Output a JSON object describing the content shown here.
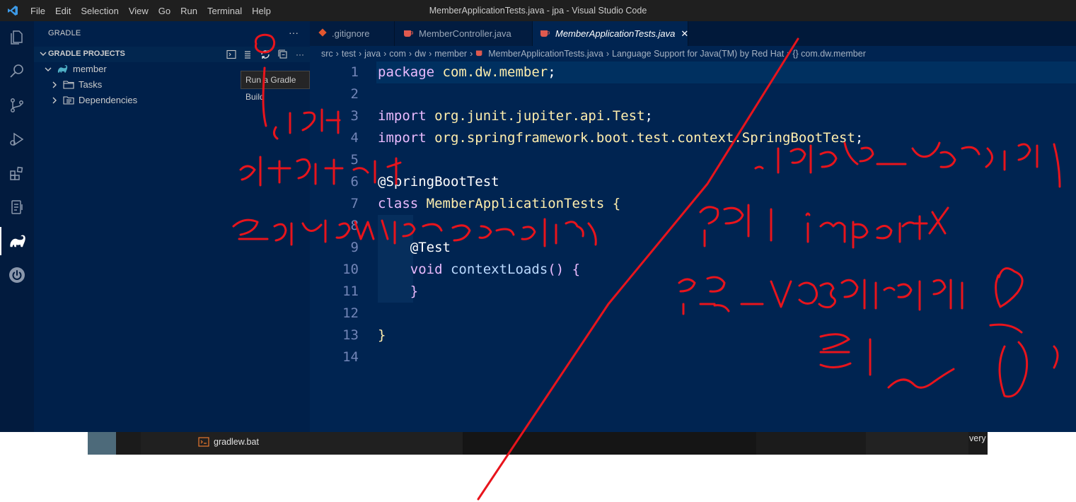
{
  "titlebar": {
    "menu": [
      "File",
      "Edit",
      "Selection",
      "View",
      "Go",
      "Run",
      "Terminal",
      "Help"
    ],
    "window_title": "MemberApplicationTests.java - jpa - Visual Studio Code"
  },
  "activity_bar": {
    "items": [
      "explorer-icon",
      "search-icon",
      "source-control-icon",
      "run-debug-icon",
      "extensions-icon",
      "test-icon",
      "gradle-icon",
      "spring-boot-icon"
    ],
    "active": "gradle-icon"
  },
  "sidebar": {
    "title": "GRADLE",
    "more": "···",
    "section_title": "GRADLE PROJECTS",
    "project": "member",
    "tree": [
      "Tasks",
      "Dependencies"
    ],
    "tooltip": "Run a Gradle Build"
  },
  "tabs": [
    {
      "label": ".gitignore",
      "icon": "gitignore-icon"
    },
    {
      "label": "MemberController.java",
      "icon": "java-icon"
    },
    {
      "label": "MemberApplicationTests.java",
      "icon": "java-icon",
      "active": true,
      "close": "✕"
    }
  ],
  "breadcrumb": [
    "src",
    "test",
    "java",
    "com",
    "dw",
    "member",
    "MemberApplicationTests.java",
    "Language Support for Java(TM) by Red Hat",
    "{} com.dw.member"
  ],
  "editor": {
    "line_numbers": [
      "1",
      "2",
      "3",
      "4",
      "5",
      "6",
      "7",
      "8",
      "9",
      "10",
      "11",
      "12",
      "13",
      "14"
    ],
    "lines": [
      "package com.dw.member;",
      "",
      "import org.junit.jupiter.api.Test;",
      "import org.springframework.boot.test.context.SpringBootTest;",
      "",
      "@SpringBootTest",
      "class MemberApplicationTests {",
      "",
      "    @Test",
      "    void contextLoads() {",
      "    }",
      "",
      "}",
      ""
    ]
  },
  "taskbar": {
    "item": "gradlew.bat",
    "right_text": "very"
  },
  "colors": {
    "editor_bg": "#002451",
    "sidebar_bg": "#00204a",
    "annotation": "#e8141c"
  }
}
